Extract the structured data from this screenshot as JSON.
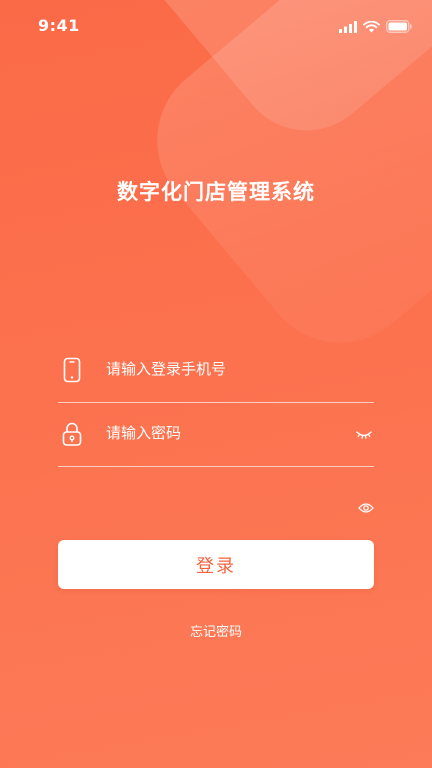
{
  "status_bar": {
    "time": "9:41",
    "icons": [
      "signal-icon",
      "wifi-icon",
      "battery-icon"
    ]
  },
  "app": {
    "title": "数字化门店管理系统"
  },
  "form": {
    "phone": {
      "placeholder": "请输入登录手机号",
      "value": "",
      "icon": "phone-icon"
    },
    "password": {
      "placeholder": "请输入密码",
      "value": "",
      "icon": "lock-icon",
      "toggle_icon": "eye-closed-icon"
    },
    "extra_toggle_icon": "eye-icon",
    "login_label": "登录",
    "forgot_label": "忘记密码"
  },
  "colors": {
    "background": "#fc7350",
    "button_bg": "#ffffff",
    "button_text": "#f4633f",
    "text": "#ffffff"
  }
}
